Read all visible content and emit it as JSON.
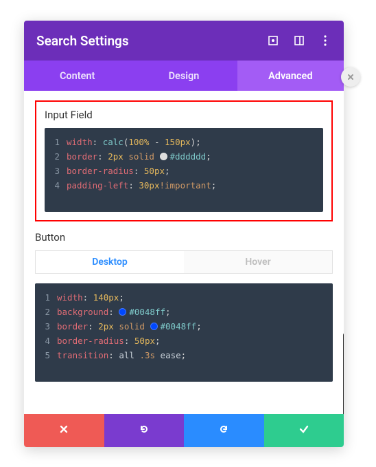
{
  "header": {
    "title": "Search Settings"
  },
  "tabs": [
    {
      "label": "Content",
      "active": false
    },
    {
      "label": "Design",
      "active": false
    },
    {
      "label": "Advanced",
      "active": true
    }
  ],
  "sections": {
    "input_field": {
      "title": "Input Field",
      "code": [
        {
          "n": "1",
          "tokens": [
            {
              "t": "width",
              "c": "prop"
            },
            {
              "t": ": ",
              "c": "punc"
            },
            {
              "t": "calc",
              "c": "func"
            },
            {
              "t": "(",
              "c": "punc"
            },
            {
              "t": "100%",
              "c": "num"
            },
            {
              "t": " - ",
              "c": "punc"
            },
            {
              "t": "150px",
              "c": "num"
            },
            {
              "t": ")",
              "c": "punc"
            },
            {
              "t": ";",
              "c": "punc"
            }
          ]
        },
        {
          "n": "2",
          "tokens": [
            {
              "t": "border",
              "c": "prop"
            },
            {
              "t": ": ",
              "c": "punc"
            },
            {
              "t": "2px",
              "c": "num"
            },
            {
              "t": " ",
              "c": "punc"
            },
            {
              "t": "solid",
              "c": "kw"
            },
            {
              "t": " ",
              "c": "punc"
            },
            {
              "swatch": "#dddddd"
            },
            {
              "t": "#dddddd",
              "c": "hex"
            },
            {
              "t": ";",
              "c": "punc"
            }
          ]
        },
        {
          "n": "3",
          "tokens": [
            {
              "t": "border-radius",
              "c": "prop"
            },
            {
              "t": ": ",
              "c": "punc"
            },
            {
              "t": "50px",
              "c": "num"
            },
            {
              "t": ";",
              "c": "punc"
            }
          ]
        },
        {
          "n": "4",
          "tokens": [
            {
              "t": "padding-left",
              "c": "prop"
            },
            {
              "t": ": ",
              "c": "punc"
            },
            {
              "t": "30px",
              "c": "num"
            },
            {
              "t": "!important",
              "c": "imp"
            },
            {
              "t": ";",
              "c": "punc"
            }
          ]
        }
      ]
    },
    "button": {
      "title": "Button",
      "subtabs": [
        {
          "label": "Desktop",
          "active": true
        },
        {
          "label": "Hover",
          "active": false
        }
      ],
      "code": [
        {
          "n": "1",
          "tokens": [
            {
              "t": "width",
              "c": "prop"
            },
            {
              "t": ": ",
              "c": "punc"
            },
            {
              "t": "140px",
              "c": "num"
            },
            {
              "t": ";",
              "c": "punc"
            }
          ]
        },
        {
          "n": "2",
          "tokens": [
            {
              "t": "background",
              "c": "prop"
            },
            {
              "t": ": ",
              "c": "punc"
            },
            {
              "swatch": "#0048ff"
            },
            {
              "t": "#0048ff",
              "c": "hex"
            },
            {
              "t": ";",
              "c": "punc"
            }
          ]
        },
        {
          "n": "3",
          "tokens": [
            {
              "t": "border",
              "c": "prop"
            },
            {
              "t": ": ",
              "c": "punc"
            },
            {
              "t": "2px",
              "c": "num"
            },
            {
              "t": " ",
              "c": "punc"
            },
            {
              "t": "solid",
              "c": "kw"
            },
            {
              "t": " ",
              "c": "punc"
            },
            {
              "swatch": "#0048ff"
            },
            {
              "t": "#0048ff",
              "c": "hex"
            },
            {
              "t": ";",
              "c": "punc"
            }
          ]
        },
        {
          "n": "4",
          "tokens": [
            {
              "t": "border-radius",
              "c": "prop"
            },
            {
              "t": ": ",
              "c": "punc"
            },
            {
              "t": "50px",
              "c": "num"
            },
            {
              "t": ";",
              "c": "punc"
            }
          ]
        },
        {
          "n": "5",
          "tokens": [
            {
              "t": "transition",
              "c": "prop"
            },
            {
              "t": ": ",
              "c": "punc"
            },
            {
              "t": "all",
              "c": "id"
            },
            {
              "t": " ",
              "c": "punc"
            },
            {
              "t": ".3s",
              "c": "time"
            },
            {
              "t": " ",
              "c": "punc"
            },
            {
              "t": "ease",
              "c": "id"
            },
            {
              "t": ";",
              "c": "punc"
            }
          ]
        }
      ]
    }
  }
}
